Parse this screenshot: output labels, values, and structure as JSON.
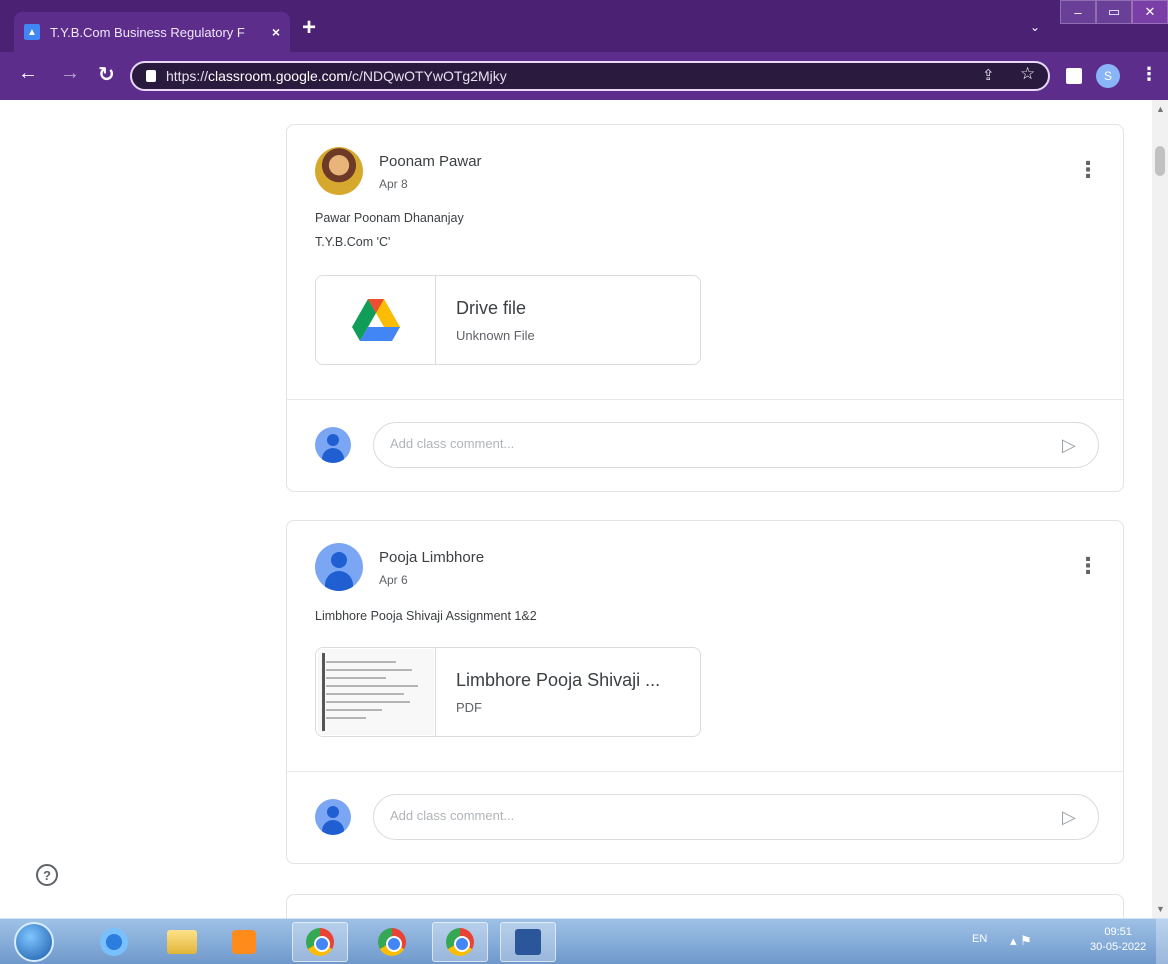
{
  "browser": {
    "tab_title": "T.Y.B.Com Business Regulatory F",
    "tab_close": "×",
    "new_tab": "+",
    "tab_search_icon": "chevron-down",
    "url_prefix": "https://",
    "url_host": "classroom.google.com",
    "url_path": "/c/NDQwOTYwOTg2Mjky",
    "profile_initial": "S"
  },
  "posts": [
    {
      "author": "Poonam Pawar",
      "date": "Apr 8",
      "lines": [
        "Pawar Poonam Dhananjay",
        "T.Y.B.Com 'C'"
      ],
      "attachment": {
        "title": "Drive file",
        "subtitle": "Unknown File",
        "icon": "google-drive-icon"
      },
      "comment_placeholder": "Add class comment..."
    },
    {
      "author": "Pooja Limbhore",
      "date": "Apr 6",
      "lines": [
        "Limbhore Pooja Shivaji Assignment 1&2"
      ],
      "attachment": {
        "title": "Limbhore Pooja Shivaji ...",
        "subtitle": "PDF",
        "icon": "pdf-thumbnail"
      },
      "comment_placeholder": "Add class comment..."
    }
  ],
  "taskbar": {
    "language": "EN",
    "time": "09:51",
    "date": "30-05-2022"
  },
  "colors": {
    "chrome_frame": "#4a2173",
    "chrome_toolbar": "#5d2d8c",
    "card_border": "#e3e3e3",
    "avatar_blue": "#7aa6f4"
  }
}
